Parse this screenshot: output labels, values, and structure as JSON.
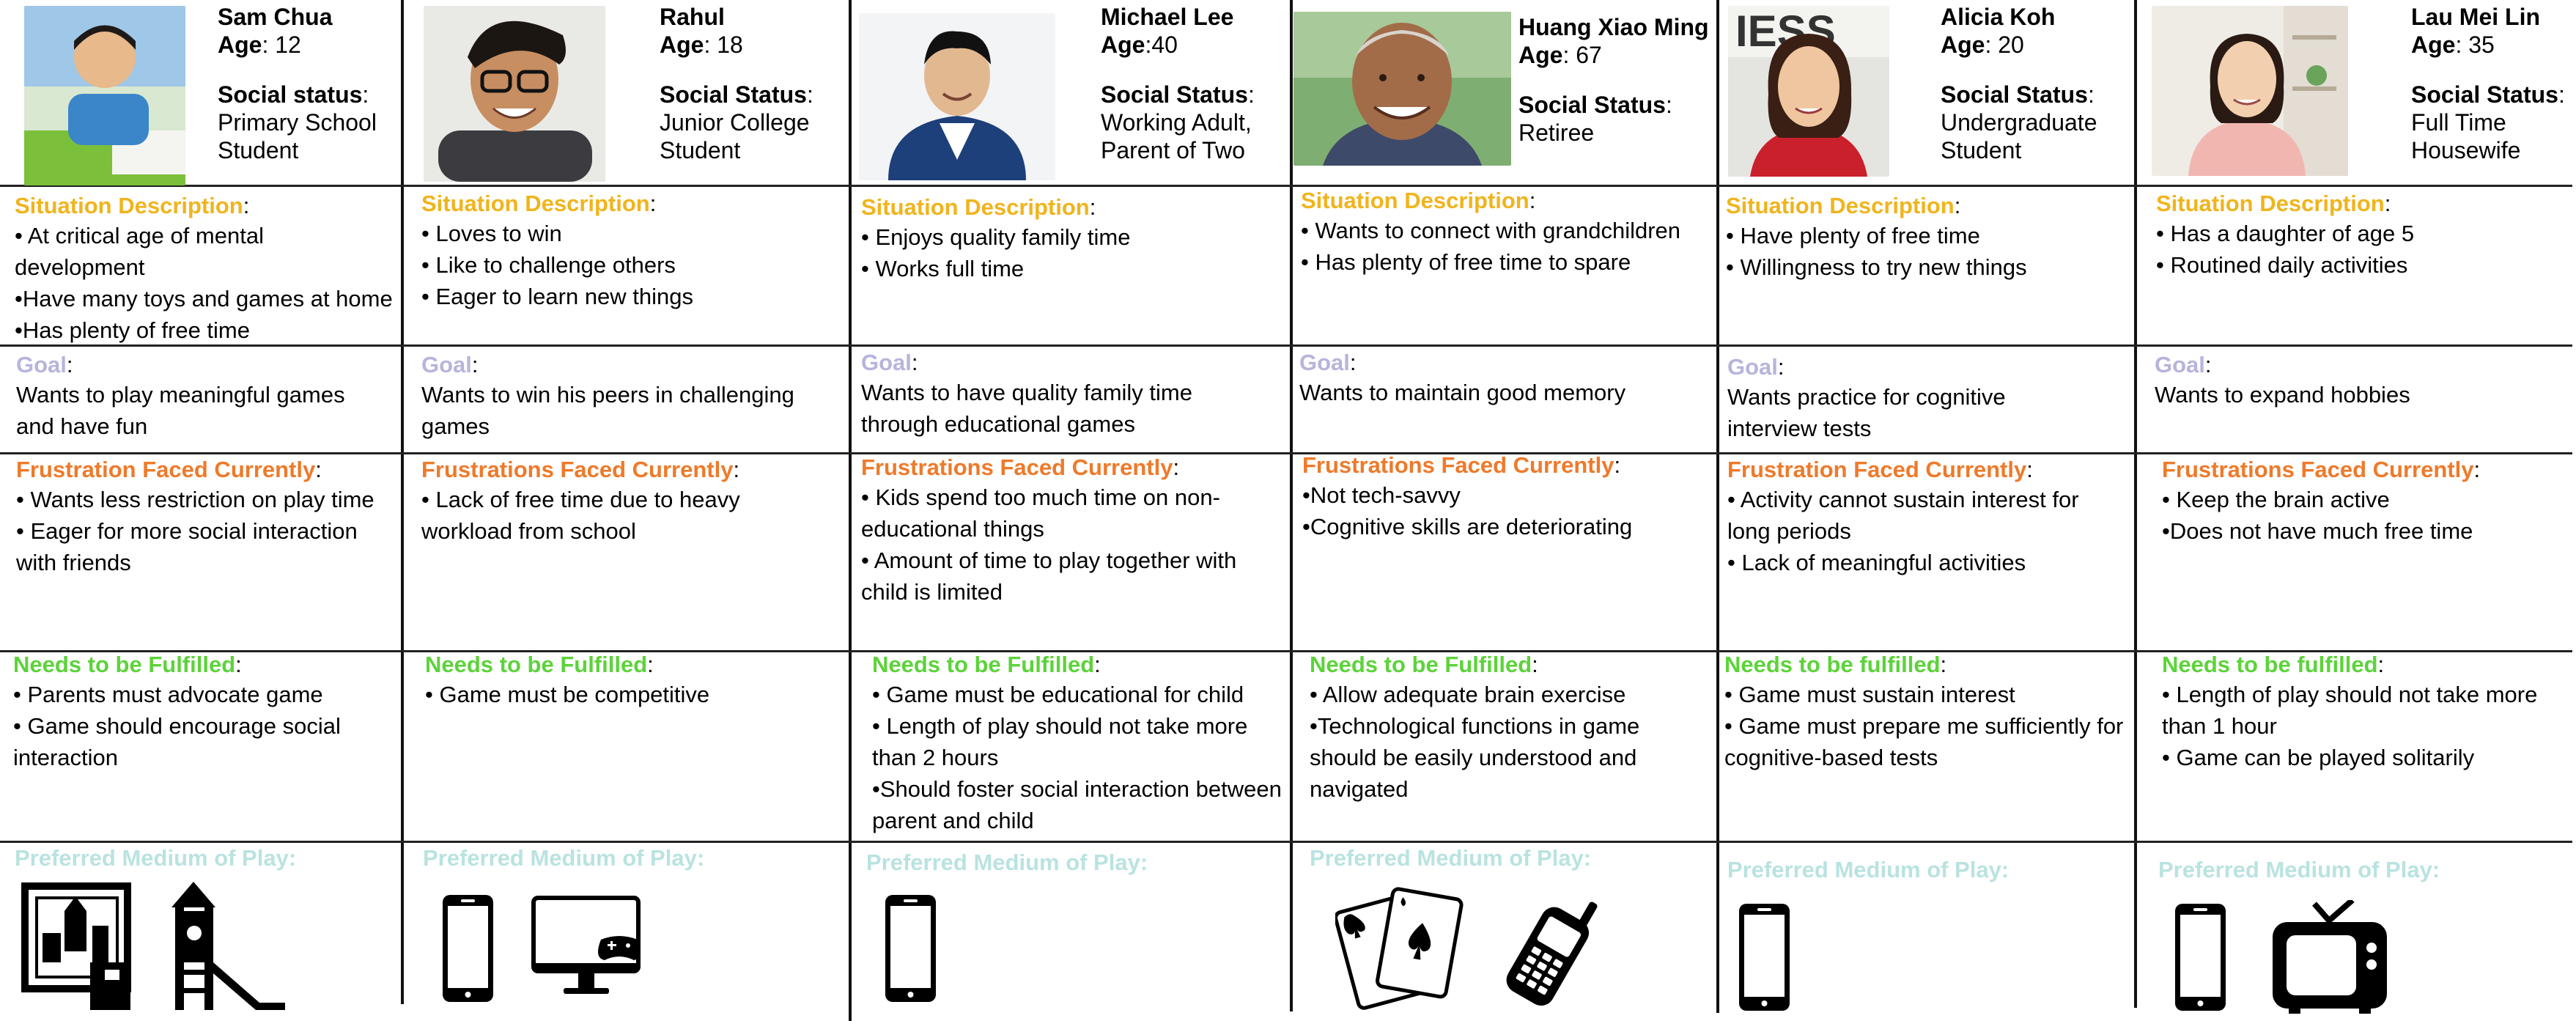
{
  "labels": {
    "situation": "Situation Description",
    "goal": "Goal",
    "frustration": "Frustration Faced Currently",
    "frustrations": "Frustrations Faced Currently",
    "needs": "Needs to be Fulfilled",
    "needs_lc": "Needs to be fulfilled",
    "medium": "Preferred Medium of Play:",
    "colon": ":"
  },
  "colors": {
    "situation": "#f0b41c",
    "goal": "#b7b4dc",
    "frustration": "#ee7a2a",
    "needs": "#5cd33a",
    "medium": "#b9e3e0"
  },
  "personas": [
    {
      "name": "Sam Chua",
      "age_label": "Age",
      "age": ": 12",
      "status_label": "Social status",
      "status_l1": ": ",
      "status_l2": "Primary School",
      "status_l3": "Student",
      "situation": [
        "• At critical age of mental development",
        "•Have many toys and games at home",
        "•Has plenty of free time"
      ],
      "goal": "Wants to play meaningful games and have fun",
      "frustrations": [
        "• Wants less restriction on play time",
        "• Eager for more social interaction with friends"
      ],
      "needs": [
        "• Parents must advocate game",
        "• Game should encourage social interaction"
      ],
      "media_icons": [
        "board-game-icon",
        "playground-slide-icon"
      ]
    },
    {
      "name": "Rahul",
      "age_label": "Age",
      "age": ": 18",
      "status_label": "Social Status",
      "status_l1": ":",
      "status_l2": "Junior College",
      "status_l3": "Student",
      "situation": [
        "• Loves to win",
        "• Like to challenge others",
        "• Eager to learn new things"
      ],
      "goal": "Wants to win his peers in challenging games",
      "frustrations": [
        "• Lack of free time due to heavy workload from school"
      ],
      "needs": [
        "• Game must be competitive"
      ],
      "media_icons": [
        "smartphone-icon",
        "computer-game-icon"
      ]
    },
    {
      "name": "Michael Lee",
      "age_label": "Age",
      "age": ":40",
      "status_label": "Social Status",
      "status_l1": ":",
      "status_l2": "Working Adult,",
      "status_l3": "Parent of Two",
      "situation": [
        "• Enjoys quality family time",
        "• Works full time"
      ],
      "goal": "Wants to have quality family time through educational games",
      "frustrations": [
        "• Kids spend too much time on non-educational things",
        "• Amount of time to play together with child is limited"
      ],
      "needs": [
        "• Game must be educational for child",
        "• Length of play should not take more than 2 hours",
        "•Should foster social interaction between parent and child"
      ],
      "media_icons": [
        "smartphone-icon"
      ]
    },
    {
      "name": "Huang Xiao Ming",
      "age_label": "Age",
      "age": ": 67",
      "status_label": "Social Status",
      "status_l1": ":",
      "status_l2": "Retiree",
      "status_l3": "",
      "situation": [
        "• Wants to connect with grandchildren",
        "• Has plenty of free time to spare"
      ],
      "goal": "Wants to maintain good memory",
      "frustrations": [
        "•Not tech-savvy",
        "•Cognitive skills are deteriorating"
      ],
      "needs": [
        "• Allow adequate brain exercise",
        "•Technological functions in game should be easily understood and navigated"
      ],
      "media_icons": [
        "playing-cards-icon",
        "mobile-phone-icon"
      ]
    },
    {
      "name": "Alicia Koh",
      "age_label": "Age",
      "age": ": 20",
      "status_label": "Social Status",
      "status_l1": ":",
      "status_l2": "Undergraduate",
      "status_l3": "Student",
      "situation": [
        "• Have plenty of free time",
        "• Willingness to try new things"
      ],
      "goal": "Wants practice for cognitive interview tests",
      "frustrations": [
        "• Activity cannot sustain interest for long periods",
        "• Lack of meaningful activities"
      ],
      "needs": [
        "• Game must sustain interest",
        "• Game must prepare me sufficiently for cognitive-based tests"
      ],
      "media_icons": [
        "smartphone-icon"
      ]
    },
    {
      "name": "Lau Mei Lin",
      "age_label": "Age",
      "age": ": 35",
      "status_label": "Social Status",
      "status_l1": ":",
      "status_l2": "Full Time",
      "status_l3": "Housewife",
      "situation": [
        "• Has a daughter of age 5",
        "• Routined daily activities"
      ],
      "goal": "Wants to expand hobbies",
      "frustrations": [
        "• Keep the brain active",
        "•Does not have much free time"
      ],
      "needs": [
        "• Length of play should not take more than 1 hour",
        "• Game can be played solitarily"
      ],
      "media_icons": [
        "smartphone-icon",
        "television-icon"
      ]
    }
  ]
}
